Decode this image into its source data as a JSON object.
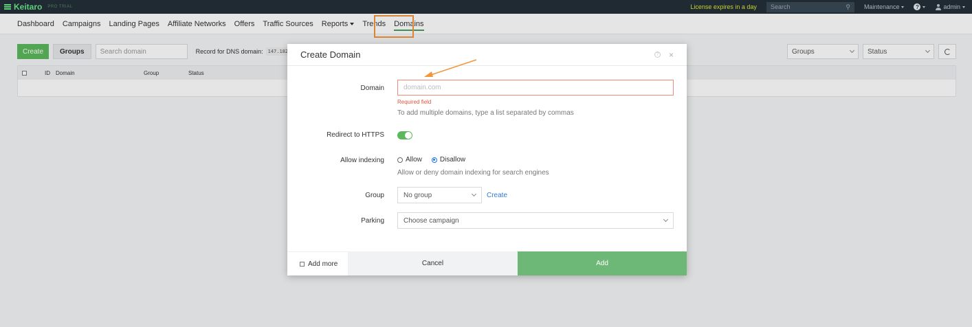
{
  "topbar": {
    "brand": "Keitaro",
    "edition": "PRO TRIAL",
    "license": "License expires in a day",
    "search_placeholder": "Search",
    "maintenance": "Maintenance",
    "help": "?",
    "user": "admin"
  },
  "nav": {
    "items": [
      {
        "label": "Dashboard"
      },
      {
        "label": "Campaigns"
      },
      {
        "label": "Landing Pages"
      },
      {
        "label": "Affiliate Networks"
      },
      {
        "label": "Offers"
      },
      {
        "label": "Traffic Sources"
      },
      {
        "label": "Reports"
      },
      {
        "label": "Trends"
      },
      {
        "label": "Domains"
      }
    ],
    "active": "Domains"
  },
  "toolbar": {
    "create_label": "Create",
    "groups_label": "Groups",
    "search_placeholder": "Search domain",
    "dns_label": "Record for DNS domain:",
    "dns_value": "147.182.",
    "groups_filter": "Groups",
    "status_filter": "Status"
  },
  "table": {
    "columns": [
      "ID",
      "Domain",
      "Group",
      "Status"
    ]
  },
  "modal": {
    "title": "Create Domain",
    "help": "?",
    "close": "×",
    "domain_label": "Domain",
    "domain_placeholder": "domain.com",
    "required": "Required field",
    "domain_hint": "To add multiple domains, type a list separated by commas",
    "https_label": "Redirect to HTTPS",
    "https_on": true,
    "indexing_label": "Allow indexing",
    "indexing_allow": "Allow",
    "indexing_disallow": "Disallow",
    "indexing_selected": "Disallow",
    "indexing_hint": "Allow or deny domain indexing for search engines",
    "group_label": "Group",
    "group_value": "No group",
    "group_create": "Create",
    "parking_label": "Parking",
    "parking_placeholder": "Choose campaign",
    "add_more": "Add more",
    "cancel": "Cancel",
    "add": "Add"
  },
  "colors": {
    "accent_green": "#5cb85c",
    "highlight_orange": "#f2953c",
    "error_red": "#e5533b",
    "link_blue": "#2f7bd1"
  }
}
